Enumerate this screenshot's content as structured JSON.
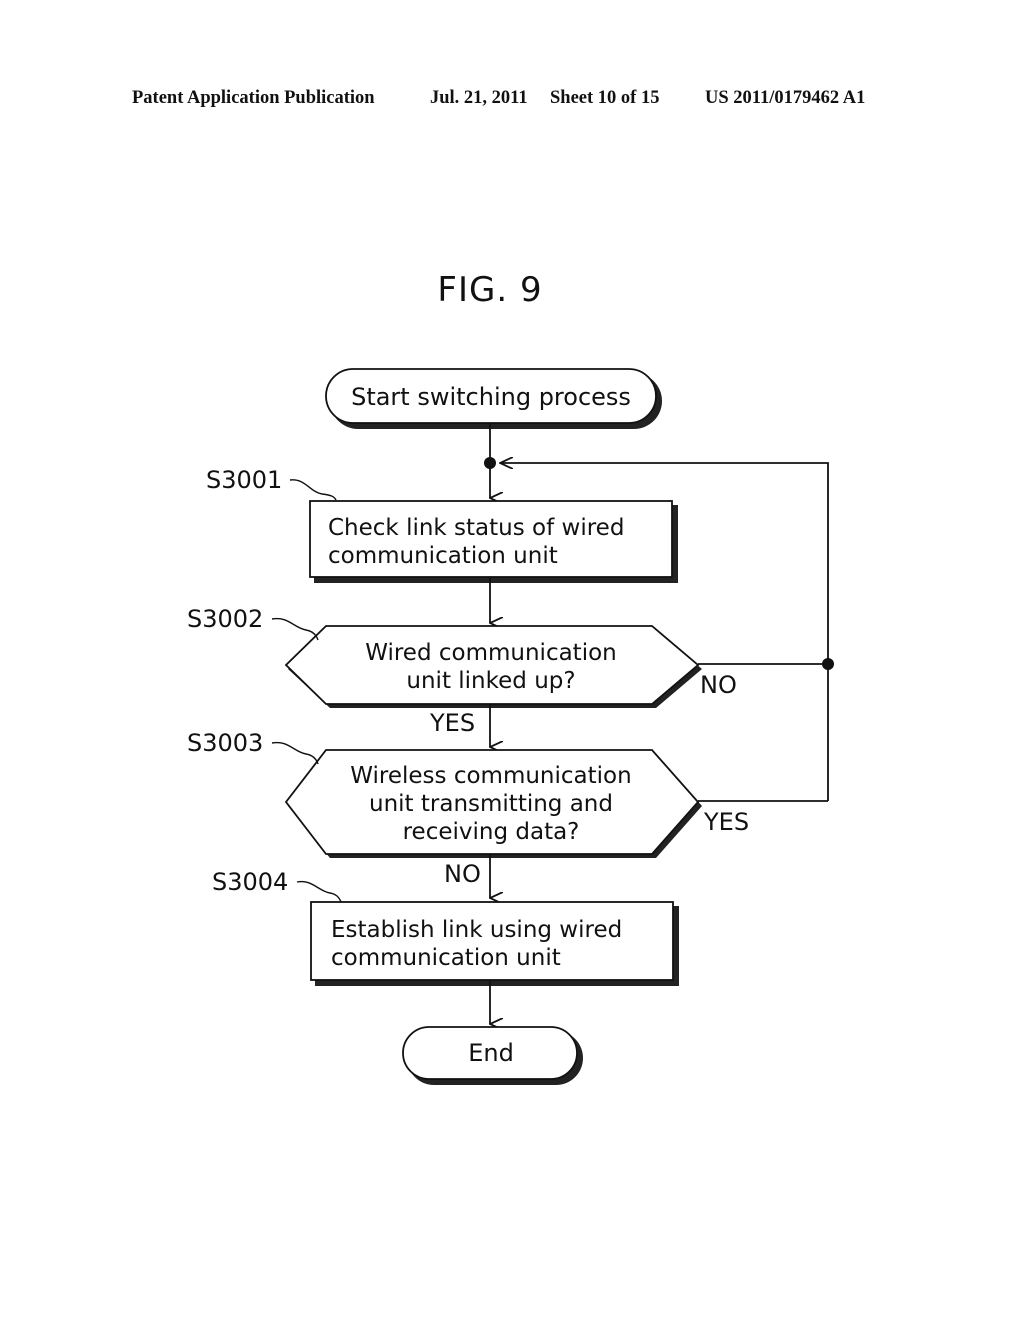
{
  "header": {
    "publication": "Patent Application Publication",
    "date": "Jul. 21, 2011",
    "sheet": "Sheet 10 of 15",
    "number": "US 2011/0179462 A1"
  },
  "figure": {
    "title": "FIG. 9"
  },
  "flowchart": {
    "start": {
      "label": "Start switching process"
    },
    "steps": [
      {
        "id": "S3001",
        "type": "process",
        "lines": [
          "Check link status of wired",
          "communication unit"
        ]
      },
      {
        "id": "S3002",
        "type": "decision",
        "lines": [
          "Wired communication",
          "unit linked up?"
        ],
        "yes_label": "YES",
        "no_label": "NO"
      },
      {
        "id": "S3003",
        "type": "decision",
        "lines": [
          "Wireless communication",
          "unit transmitting and",
          "receiving data?"
        ],
        "yes_label": "YES",
        "no_label": "NO"
      },
      {
        "id": "S3004",
        "type": "process",
        "lines": [
          "Establish link using wired",
          "communication unit"
        ]
      }
    ],
    "end": {
      "label": "End"
    }
  }
}
